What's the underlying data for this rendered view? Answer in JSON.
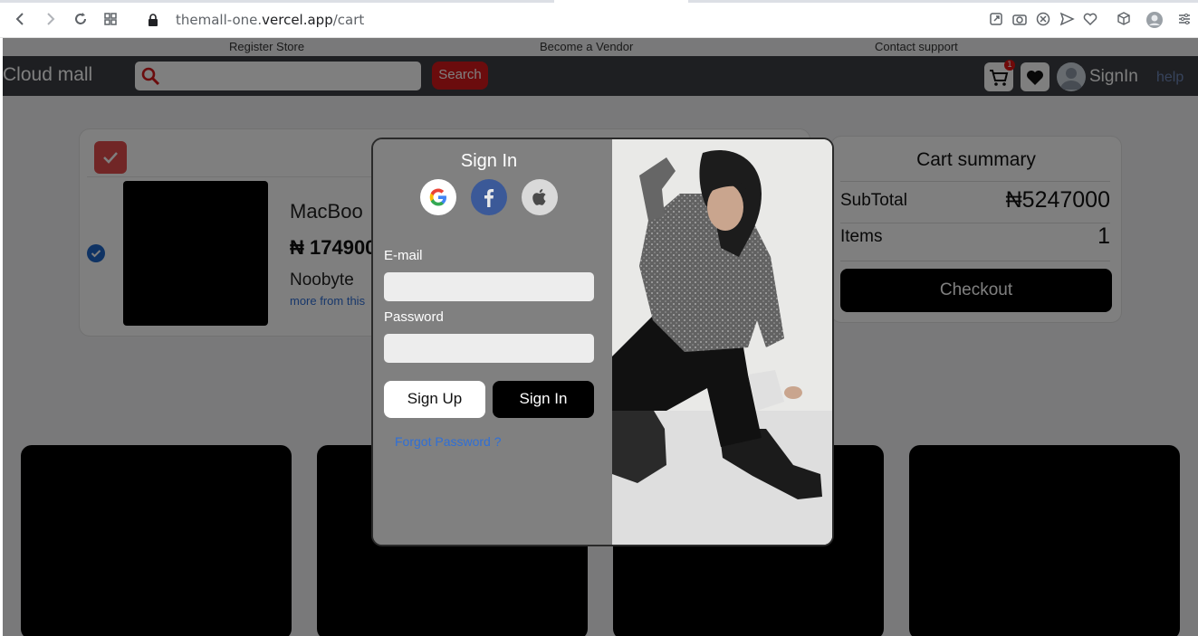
{
  "browser": {
    "url_prefix": "themall-one.",
    "url_domain": "vercel.app",
    "url_path": "/cart"
  },
  "topbar": {
    "links": [
      "Register Store",
      "Become a Vendor",
      "Contact support"
    ]
  },
  "header": {
    "brand": "Cloud mall",
    "search_placeholder": "",
    "search_button": "Search",
    "cart_badge": "1",
    "signin_label": "SignIn",
    "help_label": "help"
  },
  "cart": {
    "item": {
      "name": "MacBoo",
      "price": "₦ 174900",
      "store": "Noobyte",
      "more_link": "more from this"
    }
  },
  "summary": {
    "title": "Cart summary",
    "subtotal_label": "SubTotal",
    "subtotal_value": "₦5247000",
    "items_label": "Items",
    "items_value": "1",
    "checkout_label": "Checkout"
  },
  "modal": {
    "title": "Sign In",
    "email_label": "E-mail",
    "password_label": "Password",
    "signup_button": "Sign Up",
    "signin_button": "Sign In",
    "forgot_link": "Forgot Password ?"
  },
  "colors": {
    "accent_red": "#d6191b",
    "header_bg": "#3c3f44",
    "link_blue": "#2f6fd6"
  }
}
